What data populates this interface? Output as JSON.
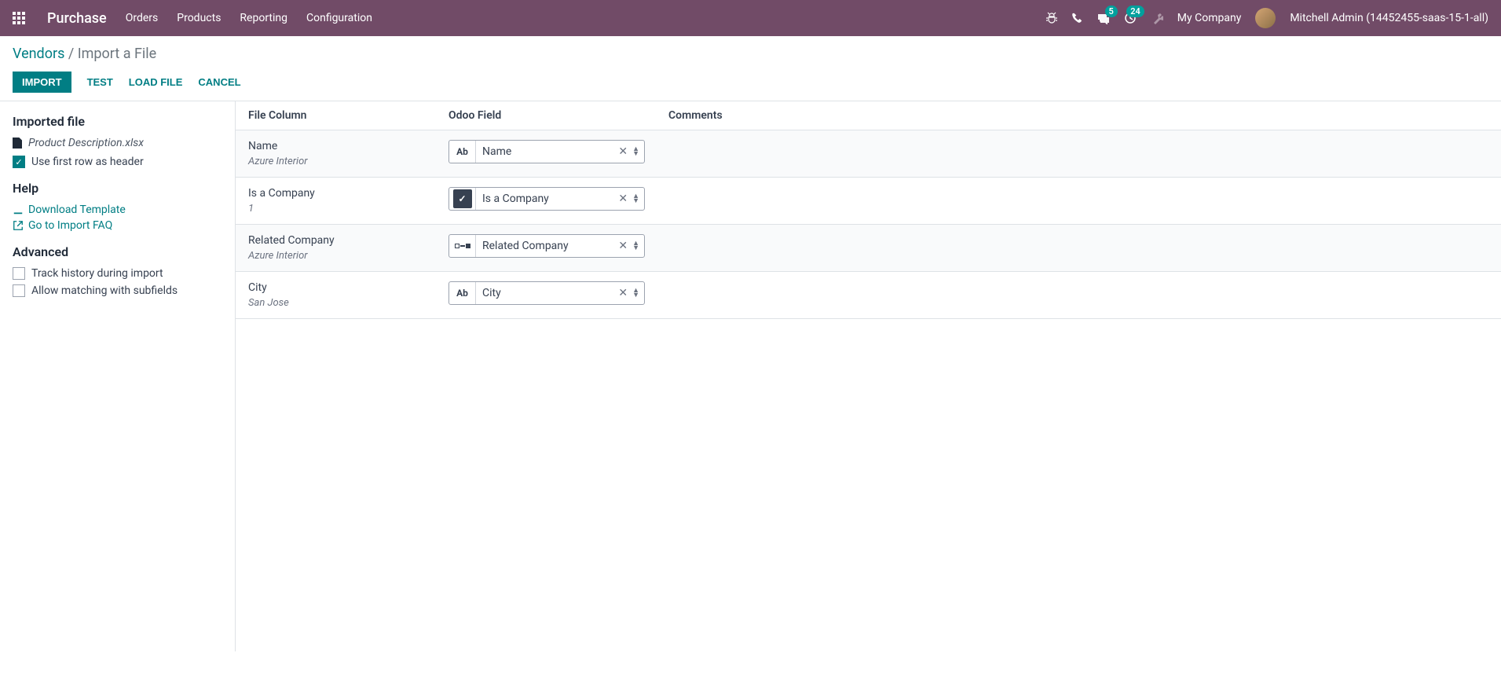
{
  "navbar": {
    "brand": "Purchase",
    "menu": [
      "Orders",
      "Products",
      "Reporting",
      "Configuration"
    ],
    "msg_count": "5",
    "activity_count": "24",
    "company": "My Company",
    "user": "Mitchell Admin (14452455-saas-15-1-all)"
  },
  "breadcrumb": {
    "parent": "Vendors",
    "current": "Import a File"
  },
  "actions": {
    "import": "IMPORT",
    "test": "TEST",
    "load": "LOAD FILE",
    "cancel": "CANCEL"
  },
  "sidebar": {
    "imported_title": "Imported file",
    "filename": "Product Description.xlsx",
    "use_header": "Use first row as header",
    "help_title": "Help",
    "download_template": "Download Template",
    "import_faq": "Go to Import FAQ",
    "advanced_title": "Advanced",
    "track_history": "Track history during import",
    "allow_subfields": "Allow matching with subfields"
  },
  "table": {
    "headers": {
      "file": "File Column",
      "field": "Odoo Field",
      "comments": "Comments"
    },
    "rows": [
      {
        "name": "Name",
        "preview": "Azure Interior",
        "field": "Name",
        "type": "text"
      },
      {
        "name": "Is a Company",
        "preview": "1",
        "field": "Is a Company",
        "type": "bool"
      },
      {
        "name": "Related Company",
        "preview": "Azure Interior",
        "field": "Related Company",
        "type": "relation"
      },
      {
        "name": "City",
        "preview": "San Jose",
        "field": "City",
        "type": "text"
      }
    ]
  }
}
